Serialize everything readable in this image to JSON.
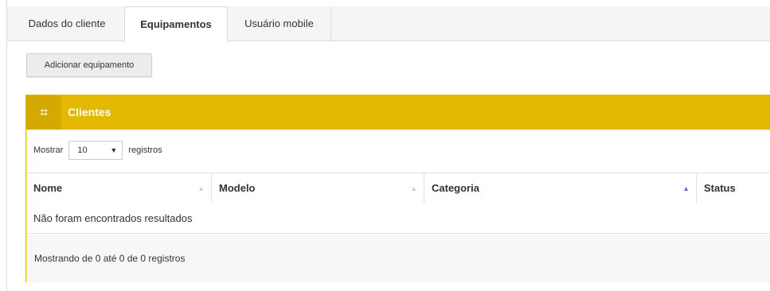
{
  "tabs": [
    "Dados do cliente",
    "Equipamentos",
    "Usuário mobile"
  ],
  "add_button": "Adicionar equipamento",
  "panel": {
    "title": "Clientes",
    "icon": "crop-icon"
  },
  "length_menu": {
    "prefix": "Mostrar",
    "value": "10",
    "suffix": "registros"
  },
  "table": {
    "columns": [
      "Nome",
      "Modelo",
      "Categoria",
      "Status"
    ],
    "sorted_column": "Categoria",
    "empty_text": "Não foram encontrados resultados"
  },
  "info": "Mostrando de 0 até 0 de 0 registros",
  "colors": {
    "accent": "#e5b800",
    "accent_dark": "#d4aa00",
    "sort_active": "#5b7ec8"
  }
}
